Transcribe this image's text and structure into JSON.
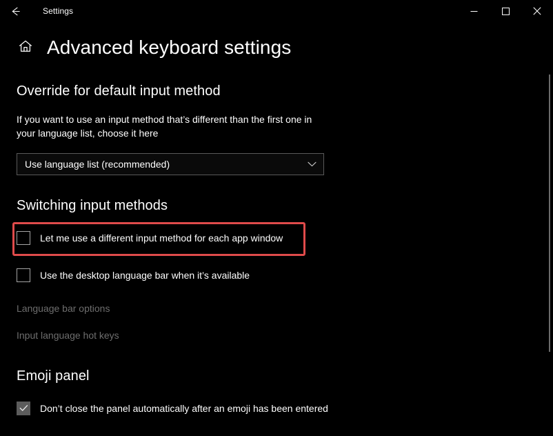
{
  "window": {
    "app_title": "Settings",
    "back_icon": "back-arrow-icon",
    "minimize_icon": "minimize-icon",
    "maximize_icon": "maximize-icon",
    "close_icon": "close-icon"
  },
  "header": {
    "home_icon": "home-icon",
    "page_title": "Advanced keyboard settings"
  },
  "override_section": {
    "heading": "Override for default input method",
    "description": "If you want to use an input method that’s different than the first one in your language list, choose it here",
    "dropdown": {
      "value": "Use language list (recommended)",
      "chevron_icon": "chevron-down-icon"
    }
  },
  "switching_section": {
    "heading": "Switching input methods",
    "checkbox_app_window": {
      "label": "Let me use a different input method for each app window",
      "checked": false,
      "highlighted": true
    },
    "checkbox_language_bar": {
      "label": "Use the desktop language bar when it’s available",
      "checked": false
    },
    "links": [
      {
        "label": "Language bar options",
        "disabled": true
      },
      {
        "label": "Input language hot keys",
        "disabled": true
      }
    ]
  },
  "emoji_section": {
    "heading": "Emoji panel",
    "checkbox_dont_close": {
      "label": "Don’t close the panel automatically after an emoji has been entered",
      "checked": true
    }
  },
  "colors": {
    "background": "#000000",
    "text": "#ffffff",
    "disabled_text": "#6e6e6e",
    "highlight_red": "#e04b4b",
    "border_grey": "#5a5a5a",
    "checkbox_border": "#a6a6a6",
    "checkbox_checked_fill": "#5c5c5c",
    "scrollbar_thumb": "#6b6b6b"
  },
  "scrollbar": {
    "name": "vertical-scrollbar"
  }
}
